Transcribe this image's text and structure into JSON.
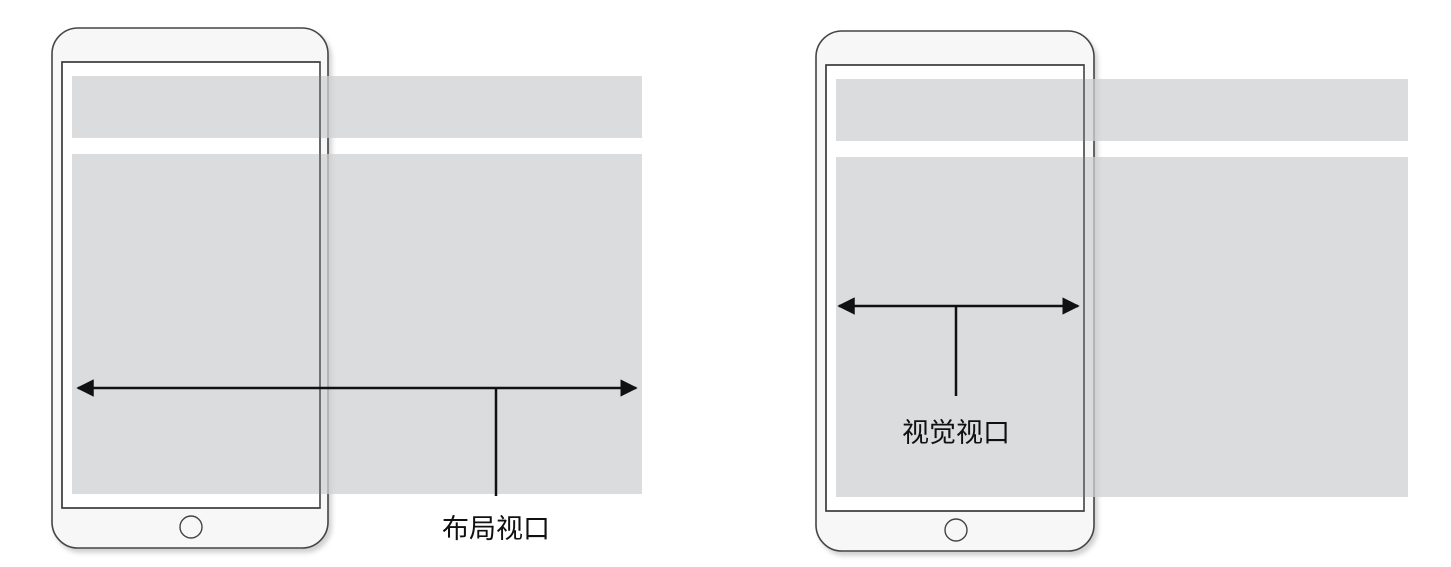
{
  "diagrams": [
    {
      "caption": "布局视口"
    },
    {
      "caption": "视觉视口"
    }
  ],
  "colors": {
    "page_block": "#dcdddf",
    "phone_fill": "#f7f7f8",
    "phone_stroke": "#444444",
    "arrow": "#111111",
    "background": "#ffffff"
  },
  "icons": [
    "phone-frame-icon",
    "home-button-icon",
    "double-arrow-icon"
  ]
}
